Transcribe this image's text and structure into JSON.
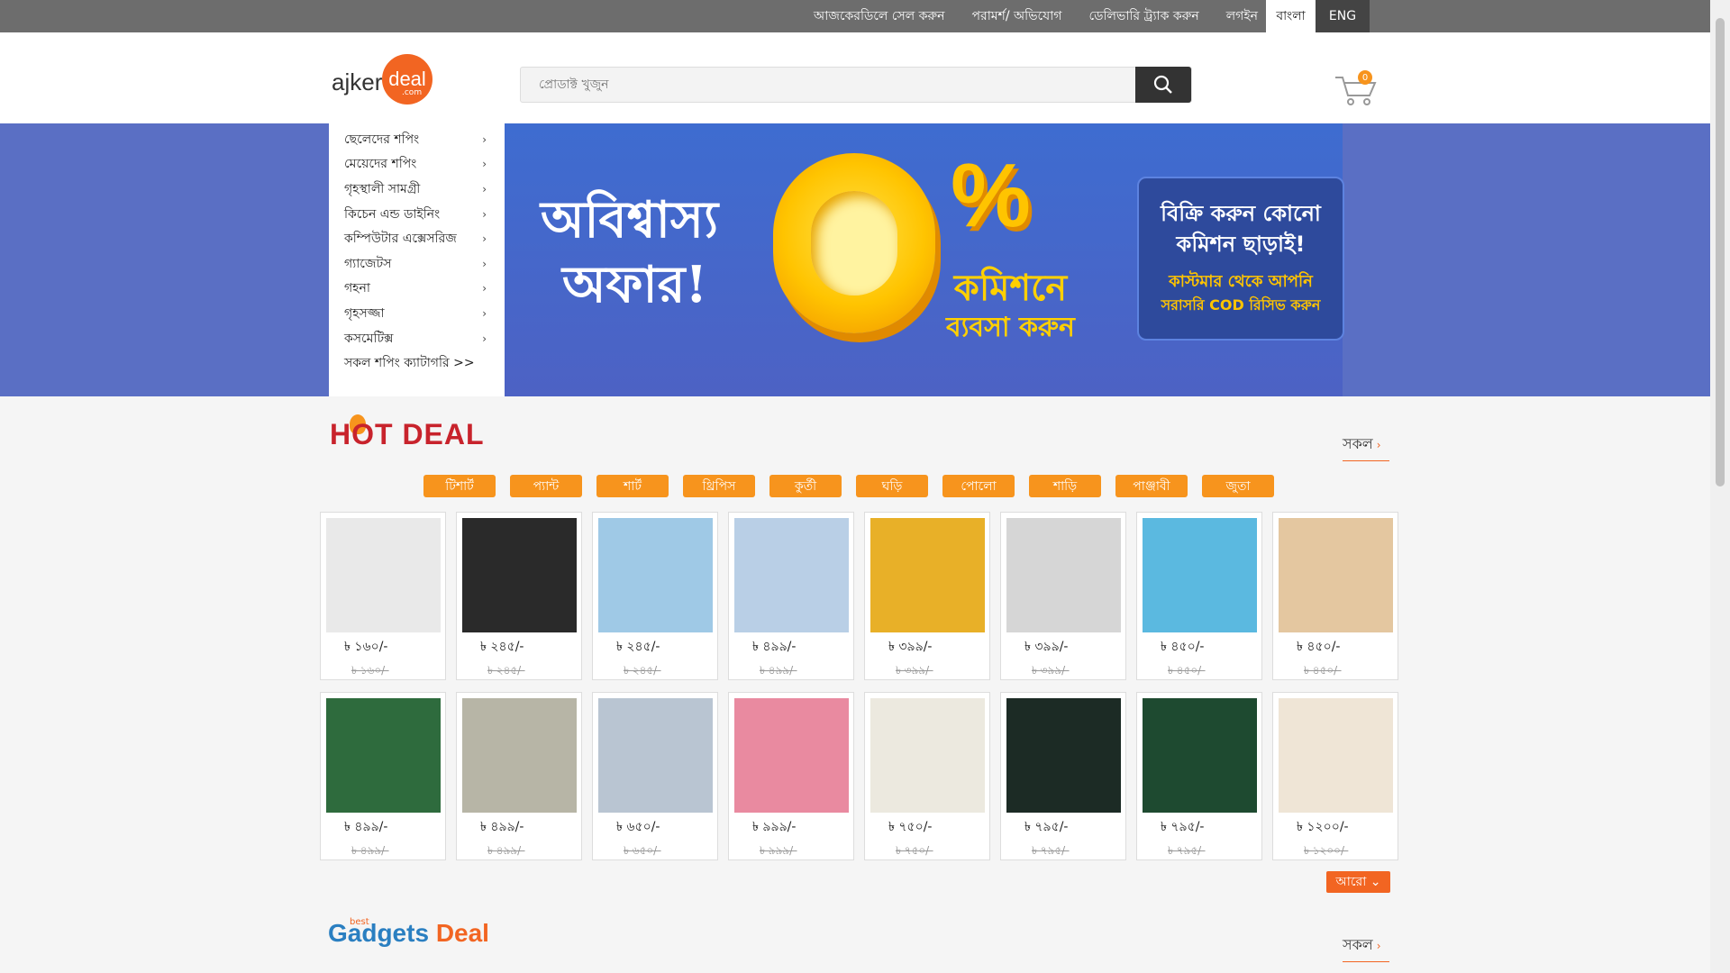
{
  "topbar": {
    "links": [
      "আজকেরডিলে সেল করুন",
      "পরামর্শ/ অভিযোগ",
      "ডেলিভারি ট্র্যাক করুন",
      "লগইন"
    ],
    "lang_bn": "বাংলা",
    "lang_en": "ENG"
  },
  "header": {
    "logo_text": "ajker",
    "logo_circle": "deal",
    "logo_com": ".com",
    "search_placeholder": "প্রোডাক্ট খুজুন",
    "cart_count": "0"
  },
  "menu": [
    "ছেলেদের শপিং",
    "মেয়েদের শপিং",
    "গৃহস্থালী সামগ্রী",
    "কিচেন এন্ড ডাইনিং",
    "কম্পিউটার এক্সেসরিজ",
    "গ্যাজেটস",
    "গহনা",
    "গৃহসজ্জা",
    "কসমেটিক্স",
    "সকল শপিং ক্যাটাগরি >>"
  ],
  "hero": {
    "line1": "অবিশ্বাস্য",
    "line2": "অফার!",
    "big_zero": "0",
    "percent": "%",
    "commission1": "কমিশনে",
    "commission2": "ব্যবসা করুন",
    "promo_l1": "বিক্রি করুন কোনো",
    "promo_l2": "কমিশন ছাড়াই!",
    "promo_l3": "কাস্টমার থেকে আপনি",
    "promo_l4": "সরাসরি COD রিসিভ করুন"
  },
  "hot_deal": {
    "title": "HOT DEAL",
    "see_all": "সকল",
    "categories": [
      "টিশার্ট",
      "প্যান্ট",
      "শার্ট",
      "থ্রিপিস",
      "কুর্তী",
      "ঘড়ি",
      "পোলো",
      "শাড়ি",
      "পাঞ্জাবী",
      "জুতা"
    ],
    "row1": [
      {
        "price": "৳ ১৬০/-",
        "old": "৳ ১৬০/-",
        "img_color": "#e9e9e9"
      },
      {
        "price": "৳ ২৪৫/-",
        "old": "৳ ২৪৫/-",
        "img_color": "#2a2a2a"
      },
      {
        "price": "৳ ২৪৫/-",
        "old": "৳ ২৪৫/-",
        "img_color": "#9fc9e6"
      },
      {
        "price": "৳ ৪৯৯/-",
        "old": "৳ ৪৯৯/-",
        "img_color": "#b9cfe6"
      },
      {
        "price": "৳ ৩৯৯/-",
        "old": "৳ ৩৯৯/-",
        "img_color": "#e8b028"
      },
      {
        "price": "৳ ৩৯৯/-",
        "old": "৳ ৩৯৯/-",
        "img_color": "#d6d6d6"
      },
      {
        "price": "৳ ৪৫০/-",
        "old": "৳ ৪৫০/-",
        "img_color": "#5bb9e0"
      },
      {
        "price": "৳ ৪৫০/-",
        "old": "৳ ৪৫০/-",
        "img_color": "#e4c7a0"
      }
    ],
    "row2": [
      {
        "price": "৳ ৪৯৯/-",
        "old": "৳ ৪৯৯/-",
        "img_color": "#2e6b3d"
      },
      {
        "price": "৳ ৪৯৯/-",
        "old": "৳ ৪৯৯/-",
        "img_color": "#b7b5a6"
      },
      {
        "price": "৳ ৬৫০/-",
        "old": "৳ ৬৫০/-",
        "img_color": "#b9c5d2"
      },
      {
        "price": "৳ ৯৯৯/-",
        "old": "৳ ৯৯৯/-",
        "img_color": "#e98aa0"
      },
      {
        "price": "৳ ৭৫০/-",
        "old": "৳ ৭৫০/-",
        "img_color": "#ece9df"
      },
      {
        "price": "৳ ৭৯৫/-",
        "old": "৳ ৭৯৫/-",
        "img_color": "#1c2b25"
      },
      {
        "price": "৳ ৭৯৫/-",
        "old": "৳ ৭৯৫/-",
        "img_color": "#1e4a30"
      },
      {
        "price": "৳ ১২০০/-",
        "old": "৳ ১২০০/-",
        "img_color": "#efe5d6"
      }
    ],
    "more": "আরো"
  },
  "gadgets": {
    "best": "best",
    "title1": "Gadgets",
    "title2": "Deal",
    "see_all": "সকল"
  }
}
